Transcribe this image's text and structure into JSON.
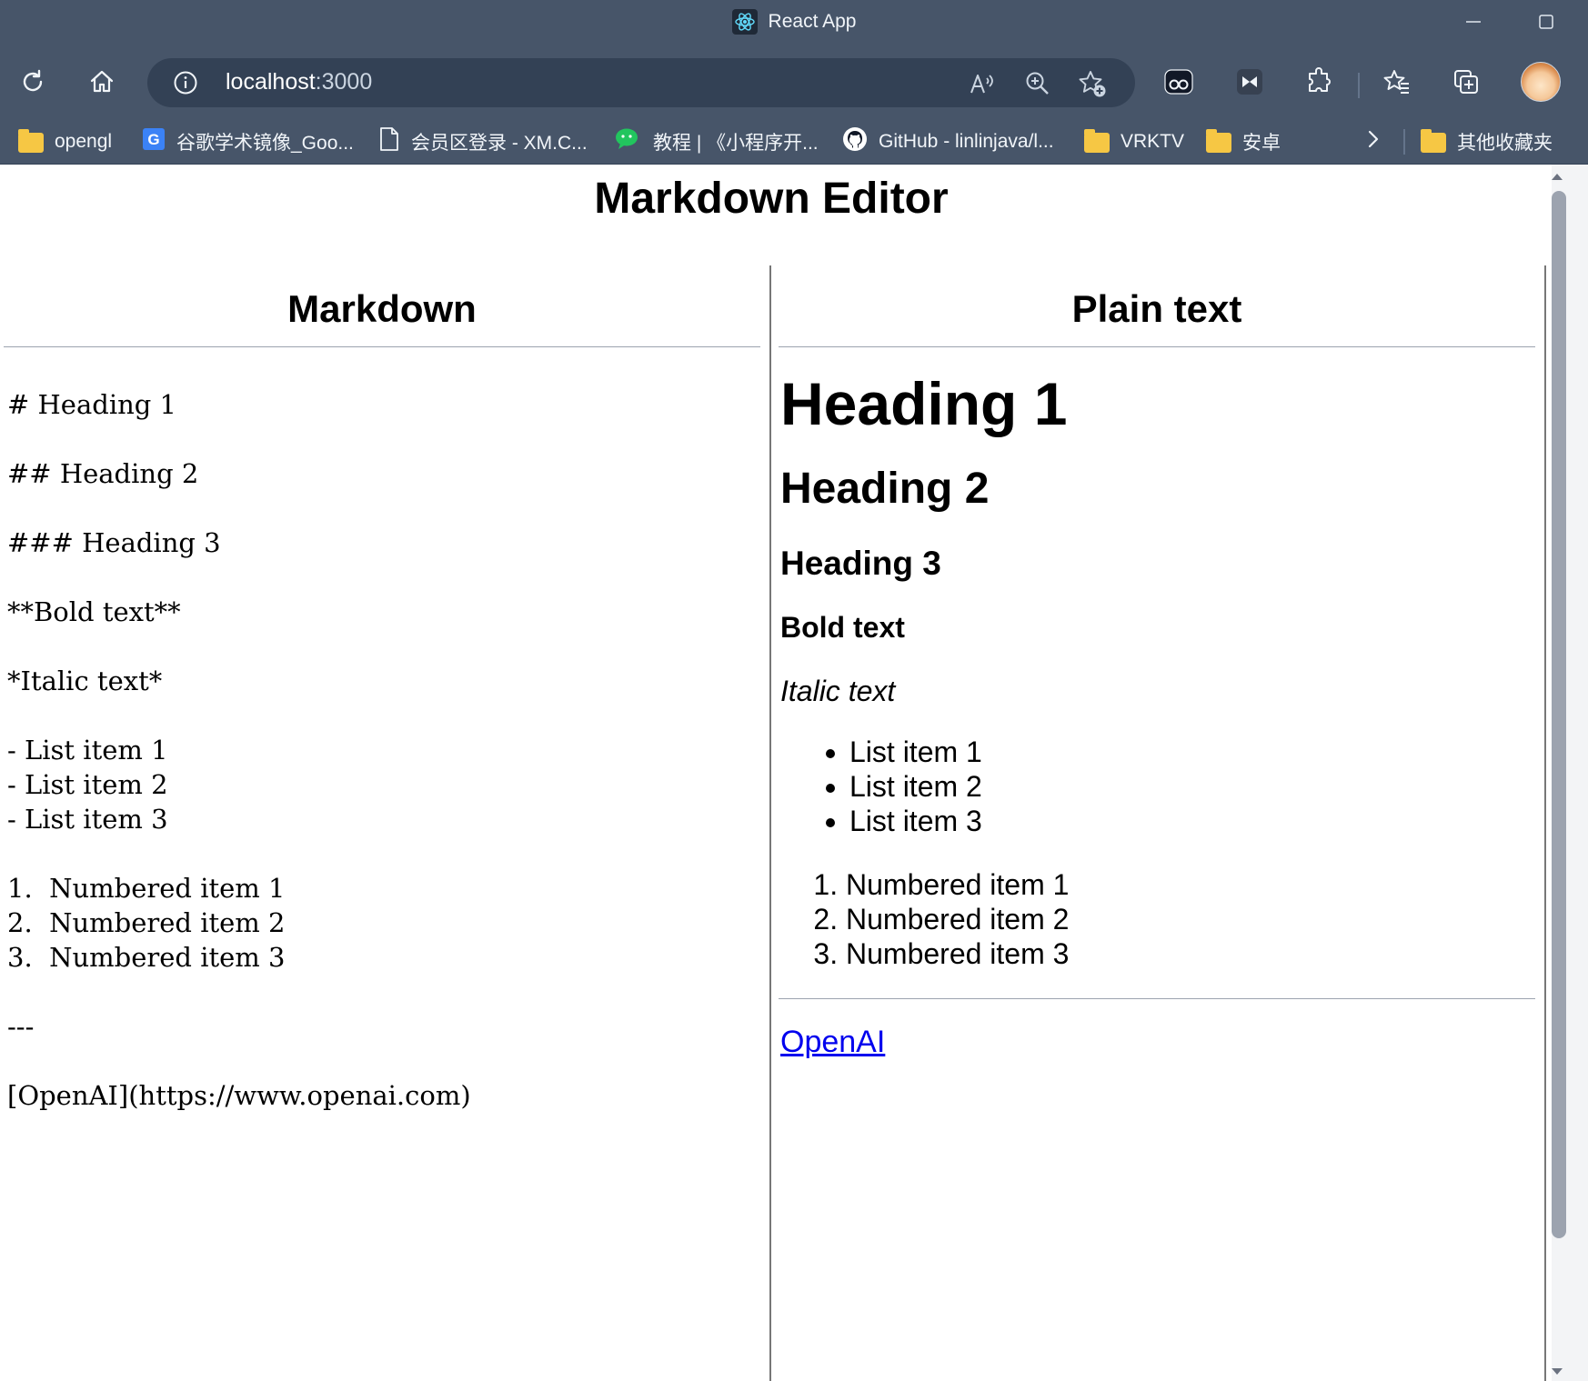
{
  "browser": {
    "window_title": "React App",
    "url_host": "localhost",
    "url_port": ":3000",
    "bookmarks": [
      {
        "label": "opengl",
        "icon": "folder-icon"
      },
      {
        "label": "谷歌学术镜像_Goo...",
        "icon": "google-scholar-icon"
      },
      {
        "label": "会员区登录 - XM.C...",
        "icon": "document-icon"
      },
      {
        "label": "教程 | 《小程序开...",
        "icon": "wechat-icon"
      },
      {
        "label": "GitHub - linlinjava/l...",
        "icon": "github-icon"
      },
      {
        "label": "VRKTV",
        "icon": "folder-icon"
      },
      {
        "label": "安卓",
        "icon": "folder-icon"
      },
      {
        "label": "其他收藏夹",
        "icon": "folder-icon"
      }
    ]
  },
  "page": {
    "title": "Markdown Editor",
    "left_heading": "Markdown",
    "right_heading": "Plain text",
    "markdown_lines": [
      "# Heading 1",
      "",
      "## Heading 2",
      "",
      "### Heading 3",
      "",
      "**Bold text**",
      "",
      "*Italic text*",
      "",
      "- List item 1",
      "- List item 2",
      "- List item 3",
      "",
      "1.  Numbered item 1",
      "2.  Numbered item 2",
      "3.  Numbered item 3",
      "",
      "---",
      "",
      "[OpenAI](https://www.openai.com)"
    ],
    "preview": {
      "h1": "Heading 1",
      "h2": "Heading 2",
      "h3": "Heading 3",
      "bold": "Bold text",
      "italic": "Italic text",
      "bullets": [
        "List item 1",
        "List item 2",
        "List item 3"
      ],
      "numbered": [
        "Numbered item 1",
        "Numbered item 2",
        "Numbered item 3"
      ],
      "link_text": "OpenAI"
    }
  }
}
